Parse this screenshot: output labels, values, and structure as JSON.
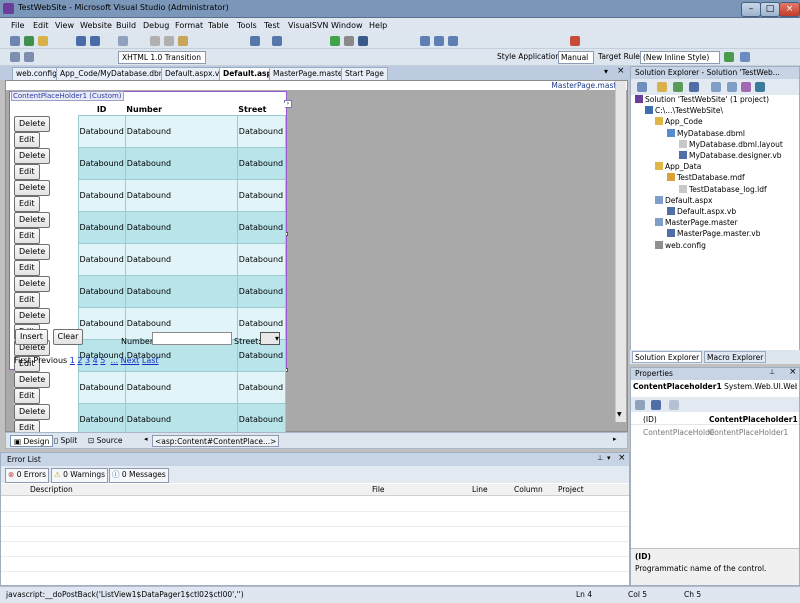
{
  "window": {
    "title": "TestWebSite - Microsoft Visual Studio (Administrator)"
  },
  "menu": [
    "File",
    "Edit",
    "View",
    "Website",
    "Build",
    "Debug",
    "Format",
    "Table",
    "Tools",
    "Test",
    "VisualSVN",
    "Window",
    "Help"
  ],
  "toolbar": {
    "doctype": "XHTML 1.0 Transition",
    "style_application_label": "Style Application:",
    "style_application_value": "Manual",
    "target_rule_label": "Target Rule:",
    "target_rule_value": "(New Inline Style)"
  },
  "doc_tabs": [
    "web.config",
    "App_Code/MyDatabase.dbml",
    "Default.aspx.vb",
    "Default.aspx",
    "MasterPage.master",
    "Start Page"
  ],
  "designer": {
    "master_label": "MasterPage.master",
    "placeholder_label": "ContentPlaceHolder1 (Custom)",
    "columns": [
      "ID",
      "Number",
      "Street"
    ],
    "rows": [
      {
        "delete": "Delete",
        "edit": "Edit",
        "id": "Databound",
        "number": "Databound",
        "street": "Databound"
      },
      {
        "delete": "Delete",
        "edit": "Edit",
        "id": "Databound",
        "number": "Databound",
        "street": "Databound"
      },
      {
        "delete": "Delete",
        "edit": "Edit",
        "id": "Databound",
        "number": "Databound",
        "street": "Databound"
      },
      {
        "delete": "Delete",
        "edit": "Edit",
        "id": "Databound",
        "number": "Databound",
        "street": "Databound"
      },
      {
        "delete": "Delete",
        "edit": "Edit",
        "id": "Databound",
        "number": "Databound",
        "street": "Databound"
      },
      {
        "delete": "Delete",
        "edit": "Edit",
        "id": "Databound",
        "number": "Databound",
        "street": "Databound"
      },
      {
        "delete": "Delete",
        "edit": "Edit",
        "id": "Databound",
        "number": "Databound",
        "street": "Databound"
      },
      {
        "delete": "Delete",
        "edit": "Edit",
        "id": "Databound",
        "number": "Databound",
        "street": "Databound"
      },
      {
        "delete": "Delete",
        "edit": "Edit",
        "id": "Databound",
        "number": "Databound",
        "street": "Databound"
      },
      {
        "delete": "Delete",
        "edit": "Edit",
        "id": "Databound",
        "number": "Databound",
        "street": "Databound"
      }
    ],
    "insert_label": "Insert",
    "clear_label": "Clear",
    "number_label": "Number:",
    "street_label": "Street:",
    "pager": {
      "first_previous": "First Previous",
      "pages": [
        "1",
        "2",
        "3",
        "4",
        "5",
        "..."
      ],
      "next": "Next",
      "last": "Last"
    }
  },
  "viewbar": {
    "design": "Design",
    "split": "Split",
    "source": "Source",
    "breadcrumb": "<asp:Content#ContentPlace...>"
  },
  "error_list": {
    "title": "Error List",
    "errors": "0 Errors",
    "warnings": "0 Warnings",
    "messages": "0 Messages",
    "columns": [
      "Description",
      "File",
      "Line",
      "Column",
      "Project"
    ]
  },
  "solution_explorer": {
    "title": "Solution Explorer - Solution 'TestWeb...",
    "tree": [
      {
        "label": "Solution 'TestWebSite' (1 project)",
        "icon": "solution-icon"
      },
      {
        "label": "C:\\...\\TestWebSite\\",
        "icon": "website-icon"
      },
      {
        "label": "App_Code",
        "icon": "folder-icon"
      },
      {
        "label": "MyDatabase.dbml",
        "icon": "dbml-icon"
      },
      {
        "label": "MyDatabase.dbml.layout",
        "icon": "file-icon"
      },
      {
        "label": "MyDatabase.designer.vb",
        "icon": "vb-file-icon"
      },
      {
        "label": "App_Data",
        "icon": "folder-icon"
      },
      {
        "label": "TestDatabase.mdf",
        "icon": "database-icon"
      },
      {
        "label": "TestDatabase_log.ldf",
        "icon": "file-icon"
      },
      {
        "label": "Default.aspx",
        "icon": "aspx-icon"
      },
      {
        "label": "Default.aspx.vb",
        "icon": "vb-file-icon"
      },
      {
        "label": "MasterPage.master",
        "icon": "master-icon"
      },
      {
        "label": "MasterPage.master.vb",
        "icon": "vb-file-icon"
      },
      {
        "label": "web.config",
        "icon": "config-icon"
      }
    ],
    "tabs": [
      "Solution Explorer",
      "Macro Explorer"
    ]
  },
  "properties": {
    "title": "Properties",
    "object": "ContentPlaceholder1",
    "object_type": "System.Web.UI.WebCo",
    "rows": [
      {
        "name": "(ID)",
        "value": "ContentPlaceholder1"
      },
      {
        "name": "ContentPlaceHolde",
        "value": "ContentPlaceHolder1"
      }
    ],
    "desc_title": "(ID)",
    "desc_text": "Programmatic name of the control."
  },
  "status": {
    "text": "javascript:__doPostBack('ListView1$DataPager1$ctl02$ctl00','')",
    "ln": "Ln 4",
    "col": "Col 5",
    "ch": "Ch 5"
  },
  "colors": {
    "row_light": "#e1f5f8",
    "row_dark": "#b8e4ea",
    "designer_bg": "#a9a9a9",
    "link": "#1530c8"
  }
}
